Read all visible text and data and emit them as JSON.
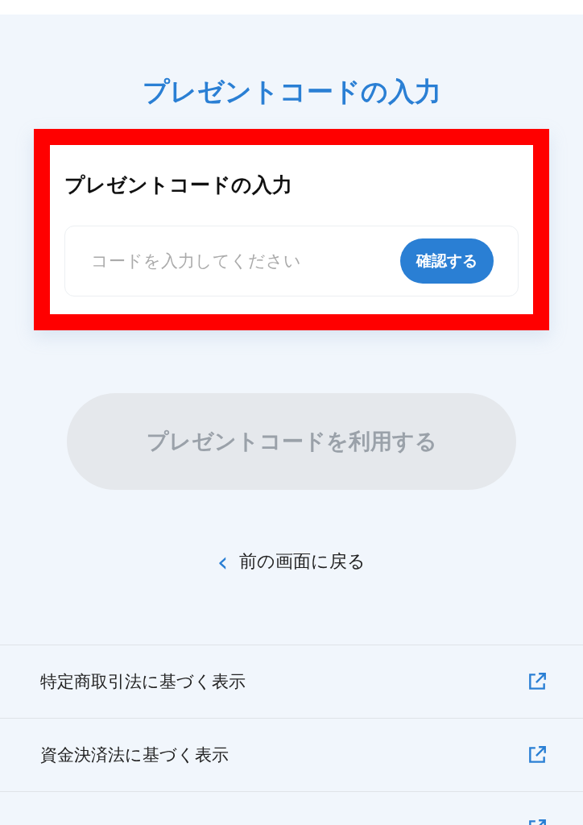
{
  "page_title": "プレゼントコードの入力",
  "card": {
    "highlighted": true,
    "title": "プレゼントコードの入力",
    "input": {
      "placeholder": "コードを入力してください"
    },
    "confirm_button": "確認する"
  },
  "use_button": {
    "label": "プレゼントコードを利用する",
    "disabled": true
  },
  "back_link": {
    "icon": "‹",
    "label": "前の画面に戻る"
  },
  "links": [
    {
      "label": "特定商取引法に基づく表示"
    },
    {
      "label": "資金決済法に基づく表示"
    }
  ],
  "partial_row_below": true
}
